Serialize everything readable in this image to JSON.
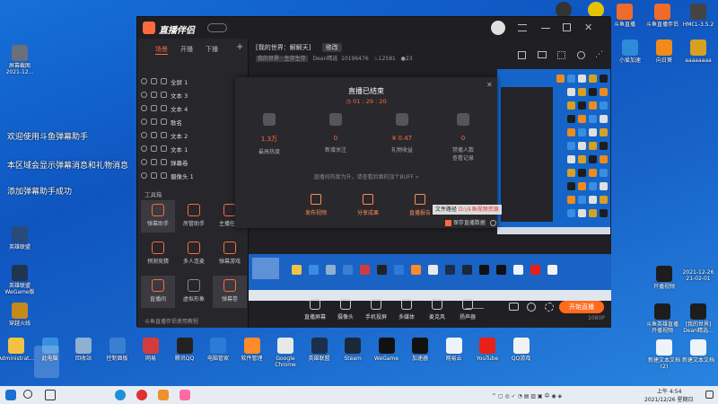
{
  "desktop_left": [
    {
      "label": "屏幕截图\n2021-12...",
      "color": "#6a6f7a"
    },
    {
      "label": "英雄联盟",
      "color": "#2a4a7a"
    },
    {
      "label": "英雄联盟\nWeGame版",
      "color": "#1f3550"
    },
    {
      "label": "穿越火线",
      "color": "#c48a1a"
    }
  ],
  "desktop_top": [
    {
      "label": "",
      "color": "#333"
    },
    {
      "label": "",
      "color": "#e6c200"
    },
    {
      "label": "斗鱼直播",
      "color": "#f06a2a"
    },
    {
      "label": "斗鱼直播伴侣",
      "color": "#f06a2a"
    },
    {
      "label": "HMCL-3.5.2",
      "color": "#444"
    },
    {
      "label": "小爱加速",
      "color": "#2d8bd8"
    },
    {
      "label": "向日葵",
      "color": "#f08a1a"
    },
    {
      "label": "aaaaaaaa",
      "color": "#d8a020"
    }
  ],
  "desktop_right": [
    {
      "label": "开播视频",
      "color": "#1d1d1d"
    },
    {
      "label": "2021-12-26\n21-02-01",
      "color": "#1d1d1d"
    },
    {
      "label": "斗鱼英雄直播\n开播视频",
      "color": "#1d1d1d"
    },
    {
      "label": "[我的世界]\nDean精选...",
      "color": "#1d1d1d"
    },
    {
      "label": "新建文本文档\n(2)",
      "color": "#eef3fa"
    },
    {
      "label": "新建文本文档",
      "color": "#eef3fa"
    }
  ],
  "desktop_bottom": [
    {
      "label": "Administrat...",
      "color": "#f2c244"
    },
    {
      "label": "此电脑",
      "color": "#3a8ee0"
    },
    {
      "label": "回收站",
      "color": "#8fb0d0"
    },
    {
      "label": "控制面板",
      "color": "#3c7fd0"
    },
    {
      "label": "网易",
      "color": "#d23c3c"
    },
    {
      "label": "腾讯QQ",
      "color": "#222"
    },
    {
      "label": "电脑管家",
      "color": "#2b7bd8"
    },
    {
      "label": "软件管理",
      "color": "#ff8a2a"
    },
    {
      "label": "Google\nChrome",
      "color": "#e8e8e8"
    },
    {
      "label": "英雄联盟",
      "color": "#1a2f4a"
    },
    {
      "label": "Steam",
      "color": "#1b2838"
    },
    {
      "label": "WeGame",
      "color": "#111"
    },
    {
      "label": "加速器",
      "color": "#111"
    },
    {
      "label": "网易云",
      "color": "#eef3fa"
    },
    {
      "label": "YouTube",
      "color": "#e62117"
    },
    {
      "label": "QQ游戏",
      "color": "#f2f2f2"
    }
  ],
  "chat_overlay": [
    "欢迎使用斗鱼弹幕助手",
    "本区域会显示弹幕消息和礼物消息",
    "添加弹幕助手成功"
  ],
  "app": {
    "logo": "直播伴侣",
    "tabs": [
      "场景",
      "开播",
      "下播"
    ],
    "title_tag": "[我的世界：解解天]",
    "edit_label": "修改",
    "sub_info": [
      "我的世界 · 生存生存",
      "Dean精选",
      "10196476",
      "12581",
      "23"
    ],
    "layers": [
      {
        "label": "全屏 1"
      },
      {
        "label": "文本 3"
      },
      {
        "label": "文本 4"
      },
      {
        "label": "歌名"
      },
      {
        "label": "文本 2"
      },
      {
        "label": "文本 1"
      },
      {
        "label": "弹幕卷"
      },
      {
        "label": "摄像头 1"
      }
    ],
    "toolbox_label": "工具箱",
    "tools": [
      {
        "label": "弹幕助手",
        "gray": false,
        "hl": true
      },
      {
        "label": "房管助手",
        "gray": false,
        "hl": false
      },
      {
        "label": "主播任务",
        "gray": false,
        "hl": false
      },
      {
        "label": "预测竞猜",
        "gray": false,
        "hl": false
      },
      {
        "label": "多人连麦",
        "gray": false,
        "hl": false
      },
      {
        "label": "弹幕游戏",
        "gray": false,
        "hl": false
      },
      {
        "label": "直播间",
        "gray": false,
        "hl": true
      },
      {
        "label": "虚拟形象",
        "gray": true,
        "hl": false
      },
      {
        "label": "弹幕卷",
        "gray": false,
        "hl": true
      }
    ],
    "footer_note": "斗鱼直播伴侣使用教程",
    "bottom_tools": [
      "直播屏幕",
      "摄像头",
      "手机投屏",
      "多媒体",
      "麦克风",
      "扬声器"
    ],
    "start_live_label": "开始直播",
    "resolution": "1080P"
  },
  "dialog": {
    "title": "直播已结束",
    "duration": "01 : 29 : 20",
    "stats": [
      {
        "value": "1.3万",
        "label": "最高热度"
      },
      {
        "value": "0",
        "label": "新增关注"
      },
      {
        "value": "¥ 0.47",
        "label": "礼物收益"
      },
      {
        "value": "0",
        "label": "禁播人数\n查看记录"
      }
    ],
    "hint": "直播间热度为升，请查看后面的加个BUFF »",
    "actions": [
      "发布视频",
      "分享成果",
      "直播报告"
    ],
    "save_path_label": "文件路径",
    "save_path_value": "D:\\斗鱼视频资源",
    "save_checkbox_label": "保存直播数据"
  },
  "taskbar": {
    "time": "上午 4:54",
    "date": "2021/12/26 星期日"
  }
}
